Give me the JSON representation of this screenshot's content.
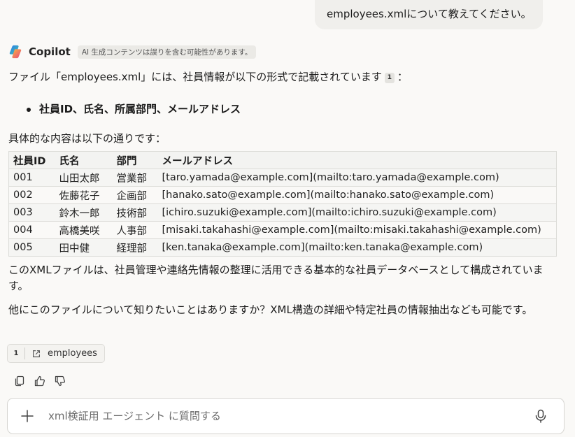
{
  "user_message": "employees.xmlについて教えてください。",
  "assistant": {
    "name": "Copilot",
    "disclaimer": "AI 生成コンテンツは誤りを含む可能性があります。",
    "intro_before": "ファイル「employees.xml」には、社員情報が以下の形式で記載されています",
    "intro_citation": "1",
    "intro_after": "：",
    "bullets": [
      "社員ID、氏名、所属部門、メールアドレス"
    ],
    "table_intro": "具体的な内容は以下の通りです：",
    "table": {
      "headers": [
        "社員ID",
        "氏名",
        "部門",
        "メールアドレス"
      ],
      "rows": [
        [
          "001",
          "山田太郎",
          "営業部",
          "[taro.yamada@example.com](mailto:taro.yamada@example.com)"
        ],
        [
          "002",
          "佐藤花子",
          "企画部",
          "[hanako.sato@example.com](mailto:hanako.sato@example.com)"
        ],
        [
          "003",
          "鈴木一郎",
          "技術部",
          "[ichiro.suzuki@example.com](mailto:ichiro.suzuki@example.com)"
        ],
        [
          "004",
          "高橋美咲",
          "人事部",
          "[misaki.takahashi@example.com](mailto:misaki.takahashi@example.com)"
        ],
        [
          "005",
          "田中健",
          "経理部",
          "[ken.tanaka@example.com](mailto:ken.tanaka@example.com)"
        ]
      ]
    },
    "summary": "このXMLファイルは、社員管理や連絡先情報の整理に活用できる基本的な社員データベースとして構成されています。",
    "followup": "他にこのファイルについて知りたいことはありますか？XML構造の詳細や特定社員の情報抽出なども可能です。",
    "sources": [
      {
        "num": "1",
        "label": "employees"
      }
    ]
  },
  "actions": [
    "copy-icon",
    "thumbs-up-icon",
    "thumbs-down-icon"
  ],
  "composer": {
    "placeholder": "xml検証用 エージェント に質問する"
  }
}
